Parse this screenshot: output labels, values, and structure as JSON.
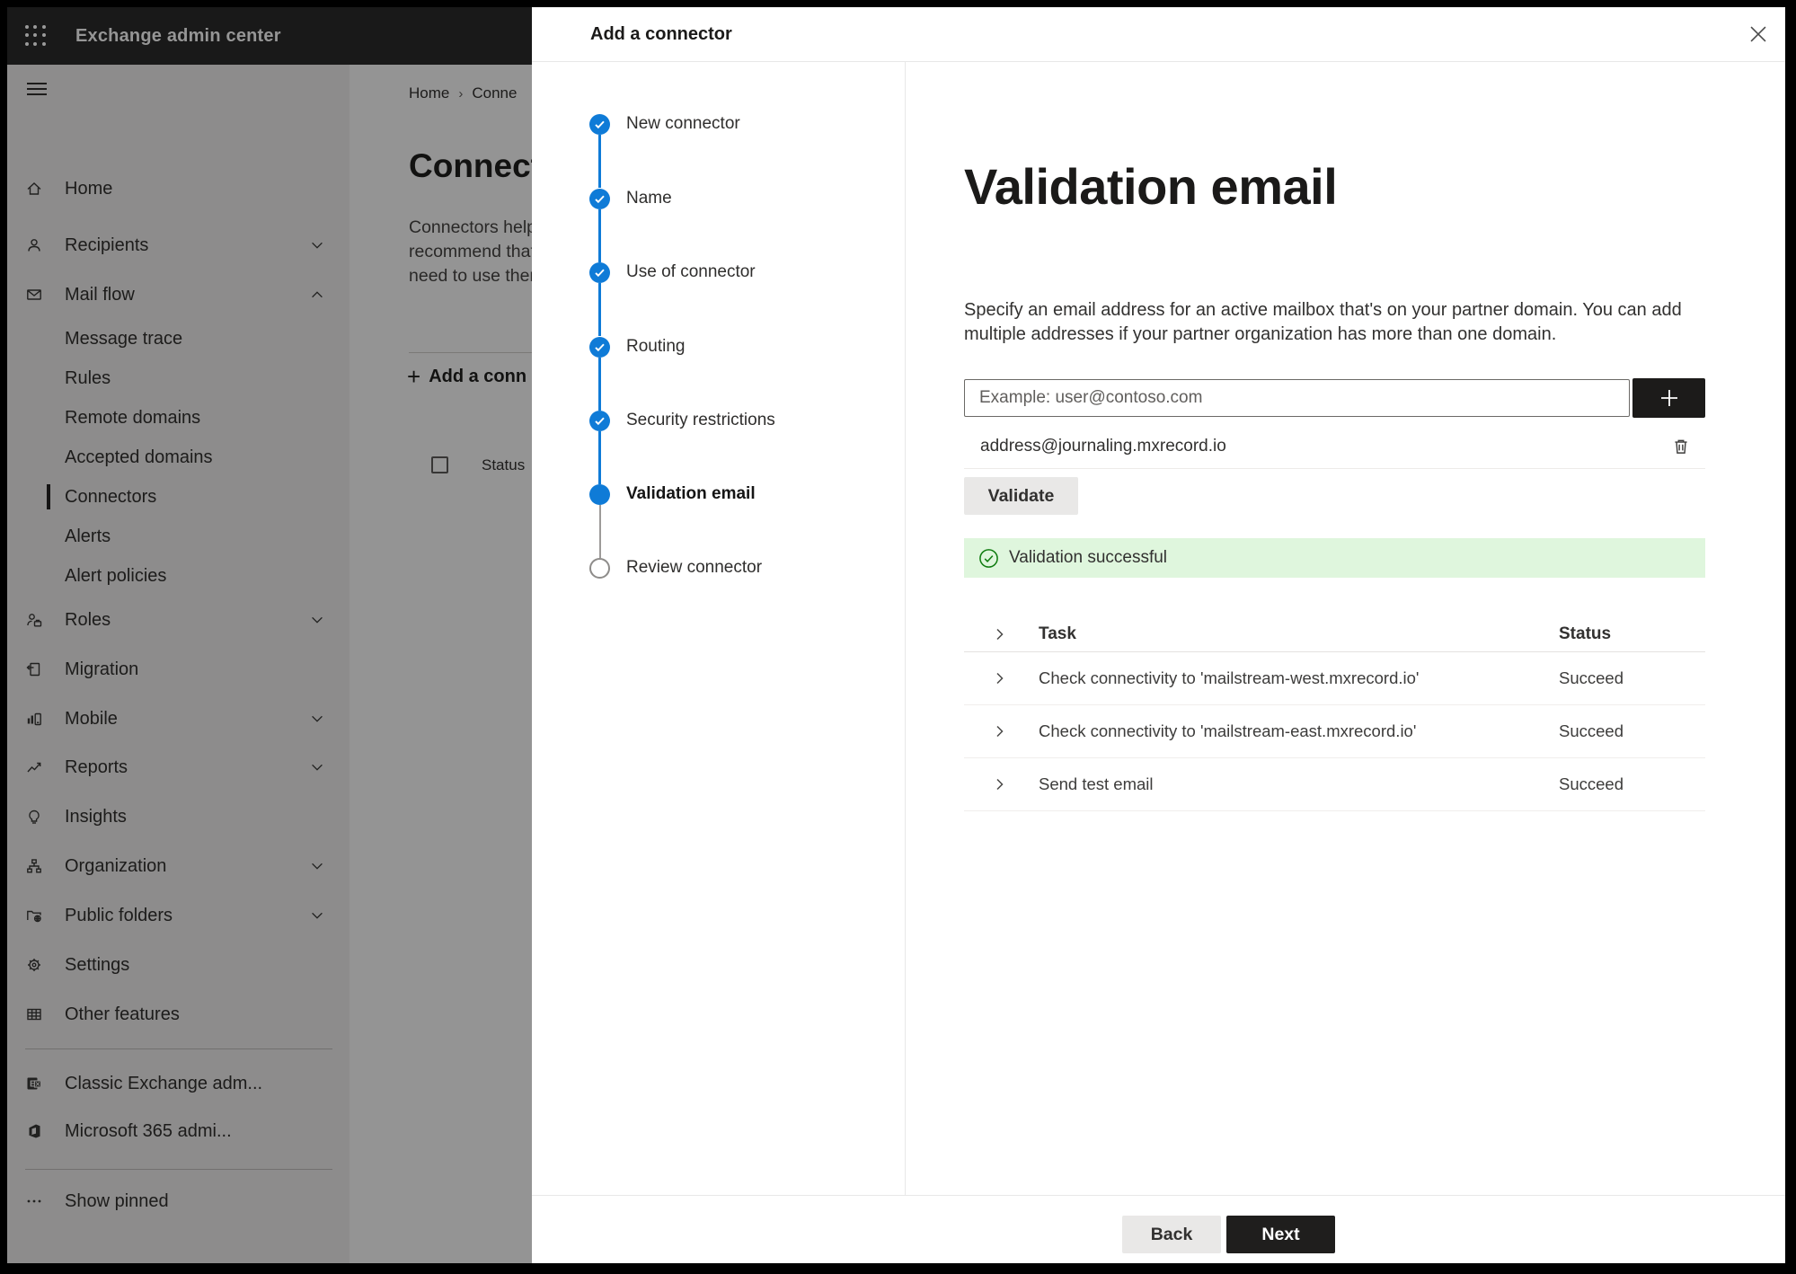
{
  "topbar": {
    "app_title": "Exchange admin center"
  },
  "sidebar": {
    "items": [
      {
        "label": "Home"
      },
      {
        "label": "Recipients"
      },
      {
        "label": "Mail flow"
      },
      {
        "label": "Message trace"
      },
      {
        "label": "Rules"
      },
      {
        "label": "Remote domains"
      },
      {
        "label": "Accepted domains"
      },
      {
        "label": "Connectors",
        "selected": true
      },
      {
        "label": "Alerts"
      },
      {
        "label": "Alert policies"
      },
      {
        "label": "Roles"
      },
      {
        "label": "Migration"
      },
      {
        "label": "Mobile"
      },
      {
        "label": "Reports"
      },
      {
        "label": "Insights"
      },
      {
        "label": "Organization"
      },
      {
        "label": "Public folders"
      },
      {
        "label": "Settings"
      },
      {
        "label": "Other features"
      },
      {
        "label": "Classic Exchange adm..."
      },
      {
        "label": "Microsoft 365 admi..."
      },
      {
        "label": "Show pinned"
      }
    ]
  },
  "background_page": {
    "breadcrumb": {
      "home": "Home",
      "current": "Conne"
    },
    "heading": "Connect",
    "paragraph_lines": {
      "l1": "Connectors help",
      "l2": "recommend that",
      "l3": "need to use ther"
    },
    "add_button_label": "Add a conn",
    "list_header_status": "Status"
  },
  "panel": {
    "title": "Add a connector",
    "steps": [
      {
        "label": "New connector",
        "state": "completed"
      },
      {
        "label": "Name",
        "state": "completed"
      },
      {
        "label": "Use of connector",
        "state": "completed"
      },
      {
        "label": "Routing",
        "state": "completed"
      },
      {
        "label": "Security restrictions",
        "state": "completed"
      },
      {
        "label": "Validation email",
        "state": "current"
      },
      {
        "label": "Review connector",
        "state": "pending"
      }
    ],
    "content": {
      "heading": "Validation email",
      "description": "Specify an email address for an active mailbox that's on your partner domain. You can add multiple addresses if your partner organization has more than one domain.",
      "email_input": {
        "placeholder": "Example: user@contoso.com",
        "value": ""
      },
      "added_address": "address@journaling.mxrecord.io",
      "validate_button_label": "Validate",
      "validation_banner": "Validation successful",
      "results_table": {
        "columns": {
          "task": "Task",
          "status": "Status"
        },
        "rows": [
          {
            "task": "Check connectivity to 'mailstream-west.mxrecord.io'",
            "status": "Succeed"
          },
          {
            "task": "Check connectivity to 'mailstream-east.mxrecord.io'",
            "status": "Succeed"
          },
          {
            "task": "Send test email",
            "status": "Succeed"
          }
        ]
      }
    },
    "footer": {
      "back_label": "Back",
      "next_label": "Next"
    }
  },
  "colors": {
    "accent": "#0f7bd7",
    "success_bg": "#dff6dd",
    "success_green": "#107c10",
    "primary_button": "#1f1e1d"
  }
}
